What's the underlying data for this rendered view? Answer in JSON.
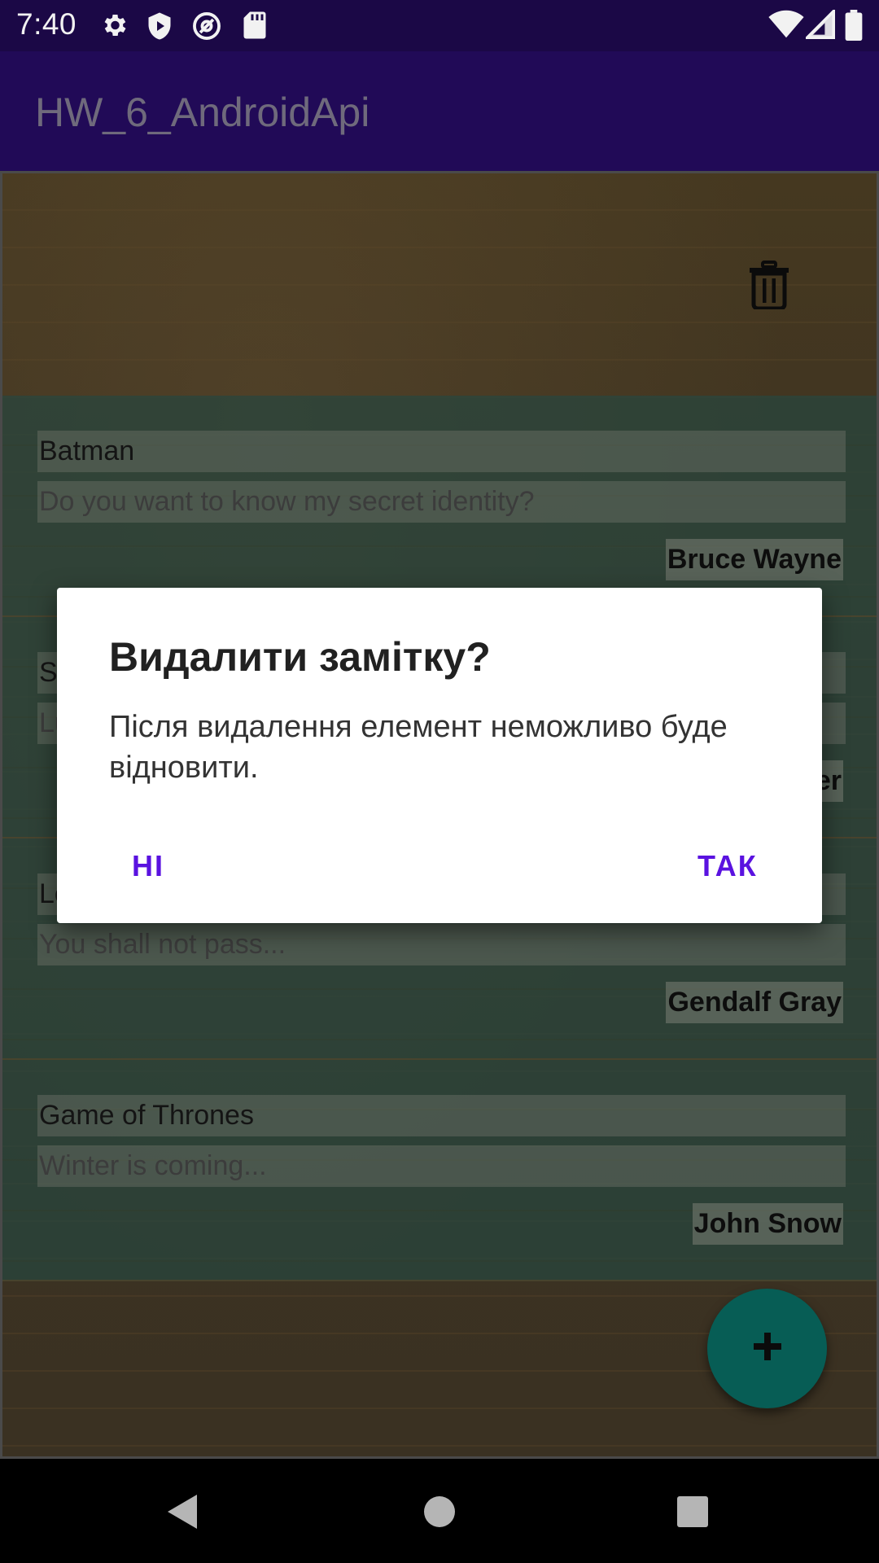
{
  "status_bar": {
    "time": "7:40",
    "left_icons": [
      "gear-icon",
      "shield-play-icon",
      "at-sign-icon",
      "sd-card-icon"
    ],
    "right_icons": [
      "wifi-icon",
      "signal-icon",
      "battery-icon"
    ]
  },
  "app_bar": {
    "title": "HW_6_AndroidApi"
  },
  "notes": [
    {
      "title": "Batman",
      "text": "Do you want to know my secret identity?",
      "author": "Bruce Wayne"
    },
    {
      "title": "St",
      "text": "Lu",
      "author": "er"
    },
    {
      "title": "Lo",
      "text": "You shall not pass...",
      "author": "Gendalf Gray"
    },
    {
      "title": "Game of Thrones",
      "text": "Winter is coming...",
      "author": "John Snow"
    }
  ],
  "dialog": {
    "title": "Видалити замітку?",
    "message": "Після видалення елемент неможливо буде відновити.",
    "negative_label": "НІ",
    "positive_label": "ТАК"
  },
  "colors": {
    "status_bar": "#1b0846",
    "app_bar": "#210a57",
    "accent": "#5a12e0",
    "fab": "#075d55"
  }
}
